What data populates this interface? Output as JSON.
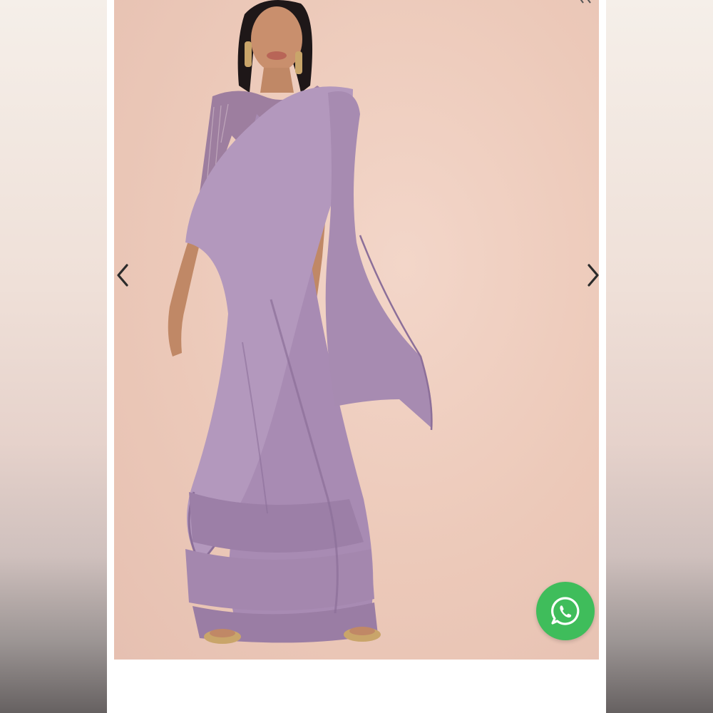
{
  "gallery": {
    "product_image": "model-wearing-ruffled-lavender-saree",
    "prev_icon": "chevron-left-icon",
    "next_icon": "chevron-right-icon"
  },
  "floating_action": {
    "icon": "whatsapp-icon",
    "color": "#3fbd5b"
  },
  "colors": {
    "backdrop": "#ecc9b9",
    "saree": "#a98ab4",
    "saree_shadow": "#8c6f99"
  }
}
